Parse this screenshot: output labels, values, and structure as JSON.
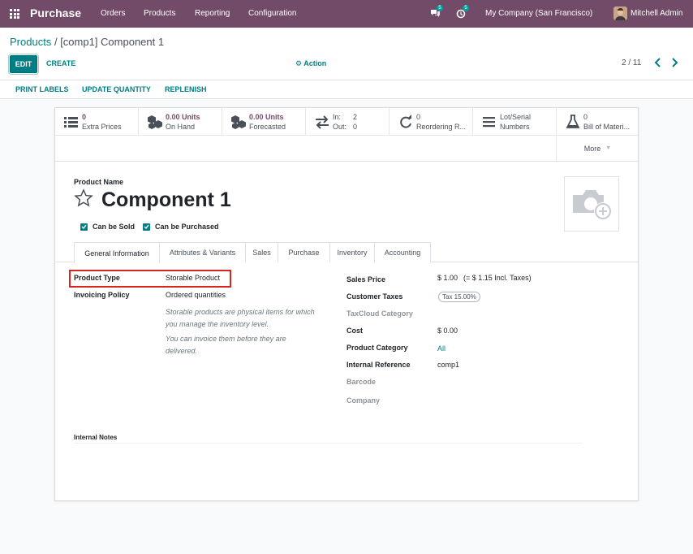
{
  "navbar": {
    "app_name": "Purchase",
    "menu": [
      "Orders",
      "Products",
      "Reporting",
      "Configuration"
    ],
    "messages_badge": "5",
    "activities_badge": "5",
    "company": "My Company (San Francisco)",
    "user": "Mitchell Admin",
    "background": "#714b67"
  },
  "breadcrumb": {
    "parent": "Products",
    "separator": "/",
    "current": "[comp1] Component 1"
  },
  "controls": {
    "edit": "EDIT",
    "create": "CREATE",
    "action": "Action",
    "pager": "2 / 11"
  },
  "statusbar": {
    "buttons": [
      "PRINT LABELS",
      "UPDATE QUANTITY",
      "REPLENISH"
    ]
  },
  "smart_buttons": [
    {
      "value": "0",
      "label": "Extra Prices",
      "icon": "list-icon"
    },
    {
      "value": "0.00 Units",
      "label": "On Hand",
      "icon": "cubes-icon"
    },
    {
      "value": "0.00 Units",
      "label": "Forecasted",
      "icon": "cubes-icon"
    },
    {
      "value": "In:",
      "value2": "2",
      "label": "Out:",
      "label2": "0",
      "icon": "exchange-icon"
    },
    {
      "value": "0",
      "label": "Reordering R...",
      "icon": "refresh-icon"
    },
    {
      "value": "Lot/Serial",
      "label": "Numbers",
      "icon": "bars-icon"
    },
    {
      "value": "0",
      "label": "Bill of Materi...",
      "icon": "flask-icon"
    }
  ],
  "more": "More",
  "product": {
    "name_label": "Product Name",
    "name": "Component 1",
    "can_be_sold": "Can be Sold",
    "can_be_purchased": "Can be Purchased"
  },
  "tabs": [
    "General Information",
    "Attributes & Variants",
    "Sales",
    "Purchase",
    "Inventory",
    "Accounting"
  ],
  "general": {
    "product_type_label": "Product Type",
    "product_type": "Storable Product",
    "invoicing_policy_label": "Invoicing Policy",
    "invoicing_policy": "Ordered quantities",
    "hint1": "Storable products are physical items for which you manage the inventory level.",
    "hint2": "You can invoice them before they are delivered.",
    "sales_price_label": "Sales Price",
    "sales_price": "$ 1.00",
    "sales_price_incl": "(= $ 1.15 Incl. Taxes)",
    "customer_taxes_label": "Customer Taxes",
    "customer_taxes": "Tax 15.00%",
    "taxcloud_label": "TaxCloud Category",
    "cost_label": "Cost",
    "cost": "$ 0.00",
    "category_label": "Product Category",
    "category": "All",
    "internal_ref_label": "Internal Reference",
    "internal_ref": "comp1",
    "barcode_label": "Barcode",
    "company_label": "Company",
    "internal_notes_label": "Internal Notes"
  }
}
